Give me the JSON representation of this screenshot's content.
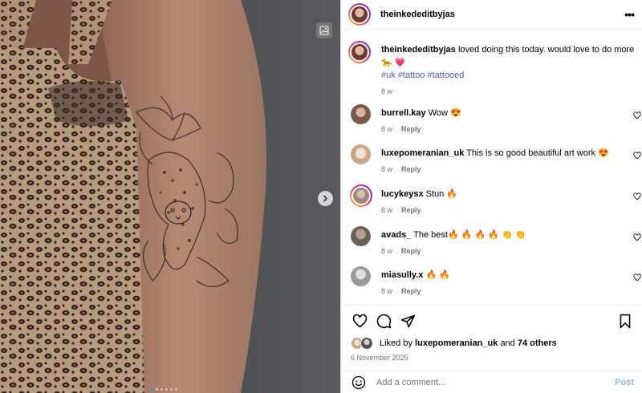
{
  "post": {
    "username": "theinkededitbyjas",
    "caption_text": "loved doing this today. would love to do more",
    "caption_emoji": "🐆 💗",
    "hashtags": [
      "#uk",
      "#tattoo",
      "#tattooed"
    ],
    "caption_time": "8 w",
    "likes_prefix": "Liked by",
    "liked_by": "luxepomeranian_uk",
    "likes_and": "and",
    "likes_others": "74 others",
    "date": "6 November 2025"
  },
  "comments": [
    {
      "user": "burrell.kay",
      "text": "Wow 😍",
      "time": "8 w",
      "reply": "Reply",
      "avatar_color": "#7a5a4a",
      "ring": false
    },
    {
      "user": "luxepomeranian_uk",
      "text": "This is so good beautiful art work 😍",
      "time": "8 w",
      "reply": "Reply",
      "avatar_color": "#c9a78a",
      "ring": false
    },
    {
      "user": "lucykeysx",
      "text": "Stun 🔥",
      "time": "8 w",
      "reply": "Reply",
      "avatar_color": "#a38a78",
      "ring": true
    },
    {
      "user": "avads_",
      "text": "The best🔥 🔥 🔥 🔥 👏 👏",
      "time": "8 w",
      "reply": "Reply",
      "avatar_color": "#6b5f58",
      "ring": false
    },
    {
      "user": "miasully.x",
      "text": "🔥 🔥",
      "time": "8 w",
      "reply": "Reply",
      "avatar_color": "#9a9a9a",
      "ring": false
    }
  ],
  "composer": {
    "placeholder": "Add a comment...",
    "post_label": "Post"
  },
  "colors": {
    "accent": "#0095f6",
    "post_disabled": "#88bde8",
    "hashtag": "#4a5fc1",
    "muted": "#737373"
  },
  "icons": [
    "media-gallery-icon",
    "chevron-right-icon",
    "more-icon",
    "heart-icon",
    "comment-icon",
    "share-icon",
    "bookmark-icon",
    "emoji-icon"
  ]
}
